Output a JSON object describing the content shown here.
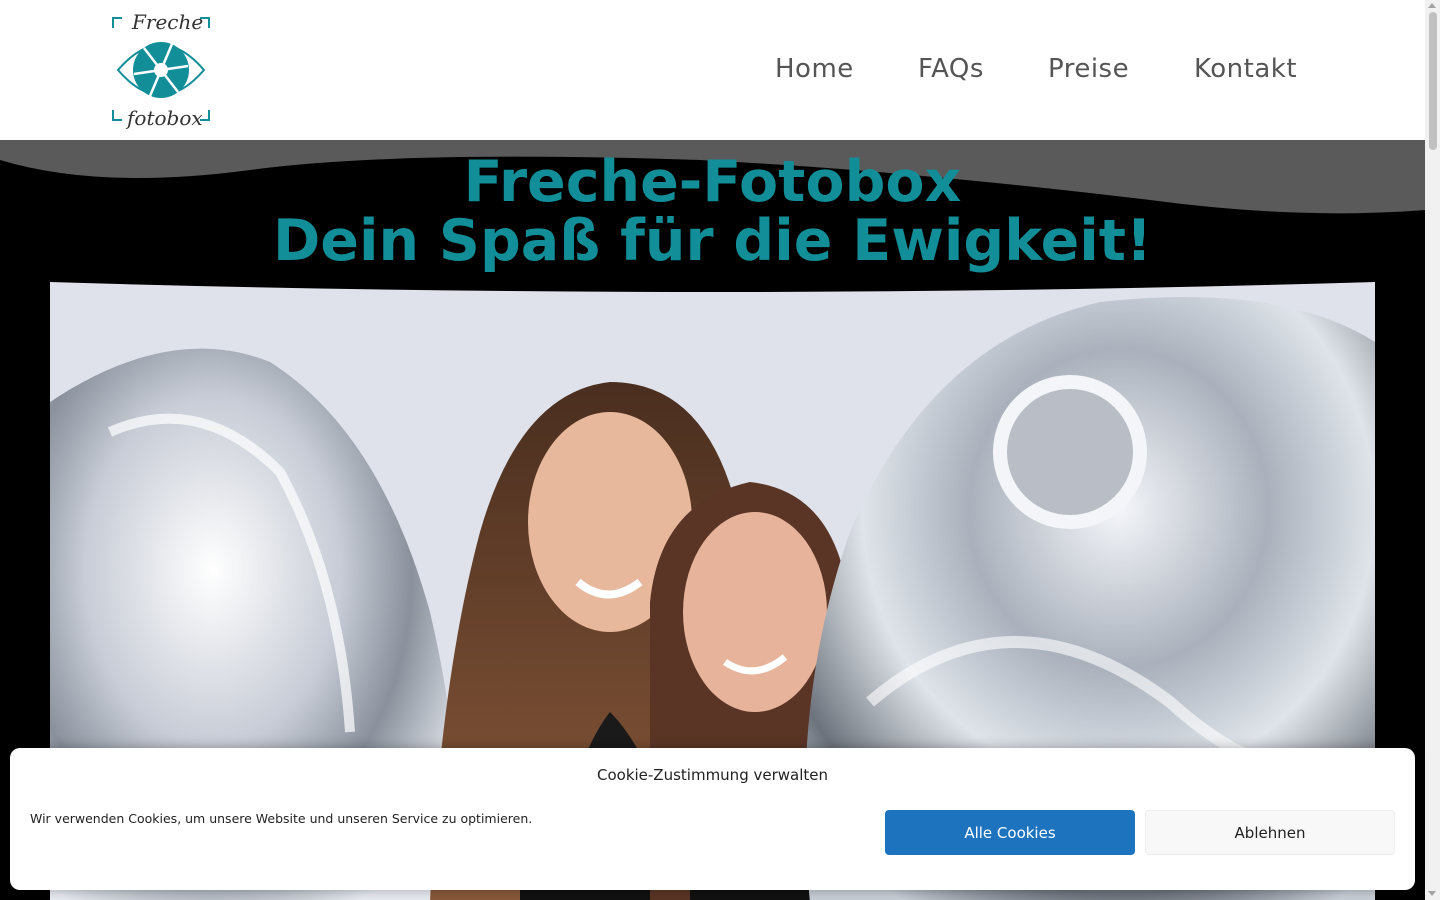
{
  "header": {
    "logo": {
      "top_text": "Freche",
      "bottom_text": "fotobox"
    },
    "nav": [
      {
        "label": "Home"
      },
      {
        "label": "FAQs"
      },
      {
        "label": "Preise"
      },
      {
        "label": "Kontakt"
      }
    ]
  },
  "hero": {
    "title_line1": "Freche-Fotobox",
    "title_line2": "Dein Spaß für die Ewigkeit!"
  },
  "cookie_banner": {
    "title": "Cookie-Zustimmung verwalten",
    "text": "Wir verwenden Cookies, um unsere Website und unseren Service zu optimieren.",
    "accept_label": "Alle Cookies",
    "deny_label": "Ablehnen"
  },
  "colors": {
    "accent": "#128e99",
    "button_primary": "#1e73be"
  }
}
